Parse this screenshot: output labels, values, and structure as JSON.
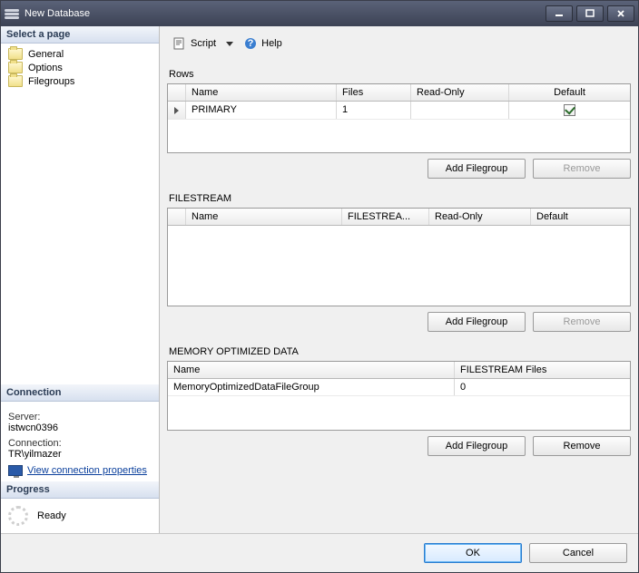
{
  "window": {
    "title": "New Database"
  },
  "sidebar": {
    "select_page_header": "Select a page",
    "pages": [
      {
        "label": "General"
      },
      {
        "label": "Options"
      },
      {
        "label": "Filegroups"
      }
    ],
    "connection": {
      "header": "Connection",
      "server_label": "Server:",
      "server_value": "istwcn0396",
      "conn_label": "Connection:",
      "conn_value": "TR\\yilmazer",
      "view_props": "View connection properties"
    },
    "progress": {
      "header": "Progress",
      "status": "Ready"
    }
  },
  "toolbar": {
    "script": "Script",
    "help": "Help"
  },
  "sections": {
    "rows": {
      "title": "Rows",
      "cols": {
        "name": "Name",
        "files": "Files",
        "readonly": "Read-Only",
        "def": "Default"
      },
      "row": {
        "name": "PRIMARY",
        "files": "1",
        "readonly": "",
        "default_checked": true
      },
      "add_btn": "Add Filegroup",
      "remove_btn": "Remove"
    },
    "filestream": {
      "title": "FILESTREAM",
      "cols": {
        "name": "Name",
        "fsfiles": "FILESTREA...",
        "readonly": "Read-Only",
        "def": "Default"
      },
      "add_btn": "Add Filegroup",
      "remove_btn": "Remove"
    },
    "memory": {
      "title": "MEMORY OPTIMIZED DATA",
      "cols": {
        "name": "Name",
        "fsfiles": "FILESTREAM Files"
      },
      "row": {
        "name": "MemoryOptimizedDataFileGroup",
        "files": "0"
      },
      "add_btn": "Add Filegroup",
      "remove_btn": "Remove"
    }
  },
  "footer": {
    "ok": "OK",
    "cancel": "Cancel"
  }
}
